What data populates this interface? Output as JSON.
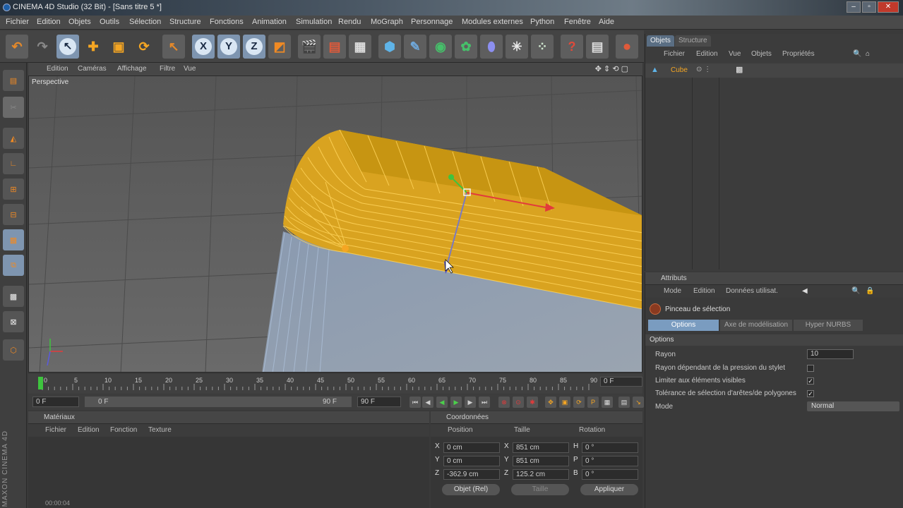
{
  "window": {
    "title": "CINEMA 4D Studio (32 Bit) - [Sans titre 5 *]"
  },
  "menu": [
    "Fichier",
    "Edition",
    "Objets",
    "Outils",
    "Sélection",
    "Structure",
    "Fonctions",
    "Animation",
    "Simulation",
    "Rendu",
    "MoGraph",
    "Personnage",
    "Modules externes",
    "Python",
    "Fenêtre",
    "Aide"
  ],
  "toolbar": {
    "axis_x": "X",
    "axis_y": "Y",
    "axis_z": "Z"
  },
  "viewport": {
    "menu": [
      "Edition",
      "Caméras",
      "Affichage",
      "Filtre",
      "Vue"
    ],
    "label": "Perspective"
  },
  "timeline": {
    "ticks": [
      "0",
      "5",
      "10",
      "15",
      "20",
      "25",
      "30",
      "35",
      "40",
      "45",
      "50",
      "55",
      "60",
      "65",
      "70",
      "75",
      "80",
      "85",
      "90"
    ],
    "current_frame": "0 F",
    "start_field": "0 F",
    "range_start": "0 F",
    "range_end": "90 F",
    "end_field": "90 F"
  },
  "materials": {
    "title": "Matériaux",
    "menu": [
      "Fichier",
      "Edition",
      "Fonction",
      "Texture"
    ],
    "timecode": "00:00:04"
  },
  "coordinates": {
    "title": "Coordonnées",
    "headers": [
      "Position",
      "Taille",
      "Rotation"
    ],
    "rows": [
      {
        "axis": "X",
        "pos": "0 cm",
        "size_axis": "X",
        "size": "851 cm",
        "rot_axis": "H",
        "rot": "0 °"
      },
      {
        "axis": "Y",
        "pos": "0 cm",
        "size_axis": "Y",
        "size": "851 cm",
        "rot_axis": "P",
        "rot": "0 °"
      },
      {
        "axis": "Z",
        "pos": "-362.9 cm",
        "size_axis": "Z",
        "size": "125.2 cm",
        "rot_axis": "B",
        "rot": "0 °"
      }
    ],
    "mode_select": "Objet (Rel)",
    "size_select": "Taille",
    "apply_button": "Appliquer"
  },
  "objects_panel": {
    "tabs": [
      "Objets",
      "Structure"
    ],
    "menu": [
      "Fichier",
      "Edition",
      "Vue",
      "Objets",
      "Propriétés"
    ],
    "items": [
      {
        "name": "Cube"
      }
    ]
  },
  "attributes_panel": {
    "title": "Attributs",
    "menu": [
      "Mode",
      "Edition",
      "Données utilisat."
    ],
    "tool_name": "Pinceau de sélection",
    "tabs": [
      "Options",
      "Axe de modélisation",
      "Hyper NURBS"
    ],
    "section": "Options",
    "rows": [
      {
        "label": "Rayon",
        "value": "10"
      },
      {
        "label": "Rayon dépendant de la pression du stylet",
        "checked": false
      },
      {
        "label": "Limiter aux éléments visibles",
        "checked": true
      },
      {
        "label": "Tolérance de sélection d'arêtes/de polygones",
        "checked": true
      },
      {
        "label": "Mode",
        "value": "Normal"
      }
    ]
  },
  "branding": "MAXON CINEMA 4D"
}
